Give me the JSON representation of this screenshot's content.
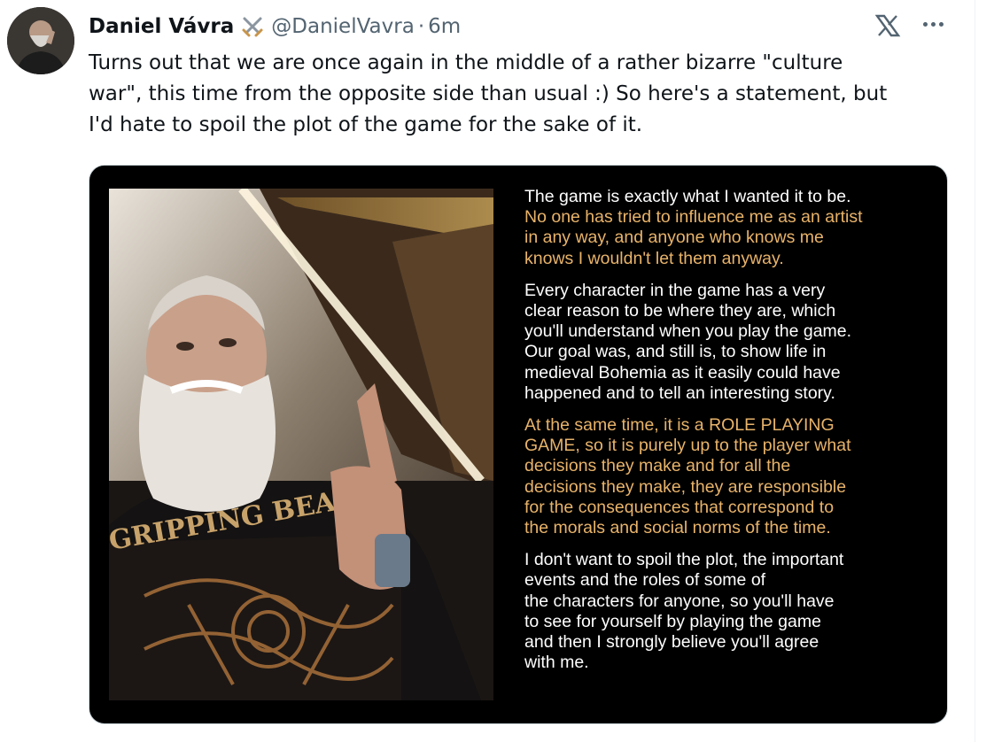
{
  "tweet": {
    "author_name": "Daniel Vávra",
    "handle": "@DanielVavra",
    "separator": "·",
    "time": "6m",
    "badge_icon": "crossed-swords-icon",
    "text": "Turns out that we are once again in the middle of a rather bizarre \"culture\nwar\", this time from the opposite side than usual :) So here's a statement, but\nI'd hate to spoil the plot of the game for the sake of it."
  },
  "toolbar": {
    "logo_icon": "x-logo-icon",
    "more_icon": "more-options-icon"
  },
  "media": {
    "photo_subject": "photo-of-bearded-man-pointing-up",
    "statement": [
      {
        "lead": "The game is exactly what I wanted it to be.",
        "text": "No one has tried to influence me as an artist\nin any way, and anyone who knows me\nknows I wouldn't let them anyway."
      },
      {
        "lead": "",
        "text": "Every character in the game has a very\nclear reason to be where they are, which\nyou'll understand when you play the game.\nOur goal was, and still is, to show life in\nmedieval Bohemia as it easily could have\nhappened and to tell an interesting story."
      },
      {
        "lead": "",
        "text": "At the same time, it is a ROLE PLAYING\nGAME, so it is purely up to the player what\ndecisions they make and for all the\ndecisions they make, they are responsible\nfor the consequences that correspond to\nthe morals and social norms of the time."
      },
      {
        "lead": "",
        "text": "I don't want to spoil the plot, the important\nevents and the roles of some of\nthe characters for anyone, so you'll have\nto see for yourself by playing the game\nand then I strongly believe you'll agree\nwith me."
      }
    ]
  },
  "colors": {
    "text_primary": "#0f1419",
    "text_secondary": "#536471",
    "statement_white": "#ffffff",
    "statement_gold": "#e8b36a"
  }
}
